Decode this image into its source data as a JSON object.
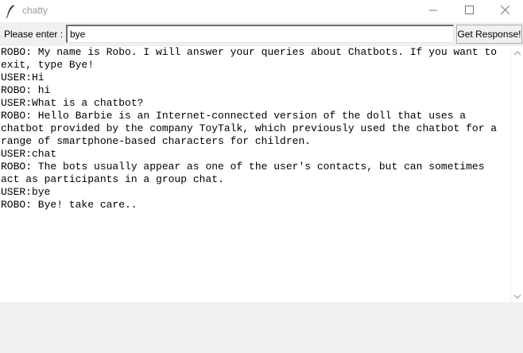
{
  "window": {
    "title": "chatty",
    "icon": "feather-icon",
    "controls": [
      "minimize-icon",
      "maximize-icon",
      "close-icon"
    ]
  },
  "input_row": {
    "label": "Please enter :",
    "entry_value": "bye",
    "button_label": "Get Response!"
  },
  "chat": {
    "lines": [
      "ROBO: My name is Robo. I will answer your queries about Chatbots. If you want to",
      "exit, type Bye!",
      "USER:Hi",
      "ROBO: hi",
      "USER:What is a chatbot?",
      "ROBO: Hello Barbie is an Internet-connected version of the doll that uses a",
      "chatbot provided by the company ToyTalk, which previously used the chatbot for a",
      "range of smartphone-based characters for children.",
      "USER:chat",
      "ROBO: The bots usually appear as one of the user's contacts, but can sometimes",
      "act as participants in a group chat.",
      "USER:bye",
      "ROBO: Bye! take care.."
    ]
  },
  "scrollbar": {
    "icons": [
      "scroll-up-icon",
      "scroll-down-icon"
    ]
  }
}
